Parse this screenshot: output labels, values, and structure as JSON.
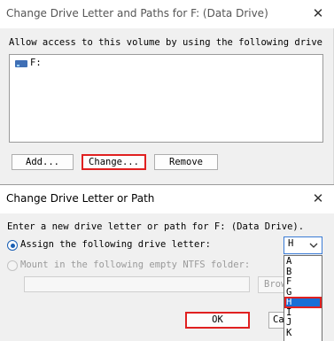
{
  "main_dialog": {
    "title": "Change Drive Letter and Paths for F: (Data Drive)",
    "description": "Allow access to this volume by using the following drive",
    "paths": [
      "F:"
    ],
    "buttons": {
      "add": "Add...",
      "change": "Change...",
      "remove": "Remove"
    }
  },
  "change_dialog": {
    "title": "Change Drive Letter or Path",
    "description": "Enter a new drive letter or path for F: (Data Drive).",
    "assign_option": "Assign the following drive letter:",
    "mount_option": "Mount in the following empty NTFS folder:",
    "browse_label": "Browse...",
    "ok_label": "OK",
    "cancel_label": "Cancel",
    "selected_letter": "H",
    "letter_options": [
      "A",
      "B",
      "F",
      "G",
      "H",
      "I",
      "J",
      "K"
    ],
    "selected_index": 4
  },
  "icons": {
    "close": "close-icon",
    "drive": "drive-icon",
    "dropdown": "chevron-down-icon"
  },
  "colors": {
    "highlight_red": "#e02020",
    "selection_blue": "#1a6fd6",
    "radio_blue": "#1a5fb4"
  }
}
